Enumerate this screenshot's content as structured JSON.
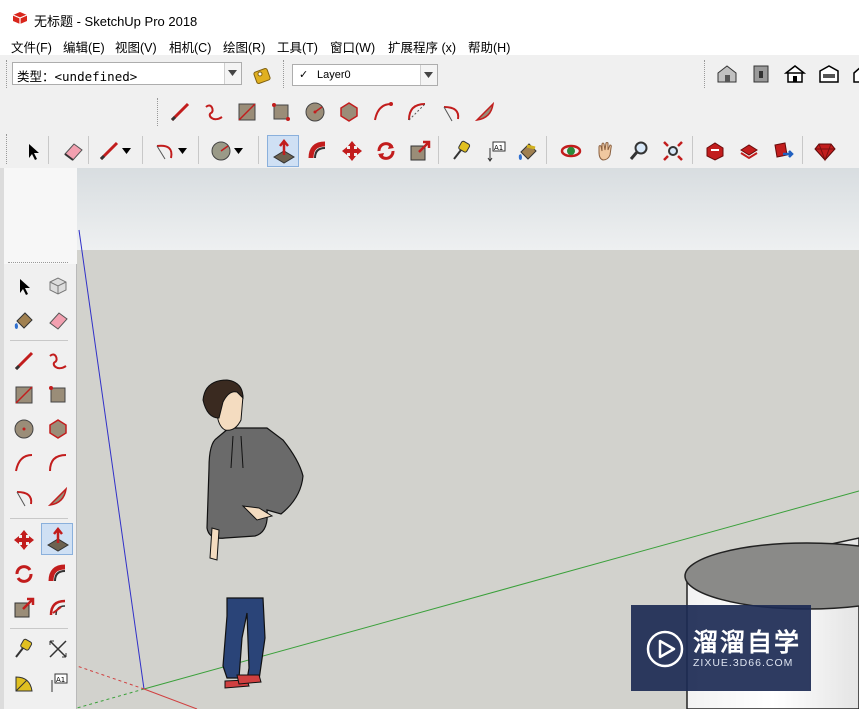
{
  "window": {
    "title": "无标题 - SketchUp Pro 2018"
  },
  "menu": [
    {
      "id": "file",
      "label": "文件(F)"
    },
    {
      "id": "edit",
      "label": "编辑(E)"
    },
    {
      "id": "view",
      "label": "视图(V)"
    },
    {
      "id": "camera",
      "label": "相机(C)"
    },
    {
      "id": "draw",
      "label": "绘图(R)"
    },
    {
      "id": "tools",
      "label": "工具(T)"
    },
    {
      "id": "window",
      "label": "窗口(W)"
    },
    {
      "id": "extensions",
      "label": "扩展程序 (x)"
    },
    {
      "id": "help",
      "label": "帮助(H)"
    }
  ],
  "classifier": {
    "label": "类型：<undefined>"
  },
  "layers": {
    "current": "Layer0",
    "check": "✓"
  },
  "toolbars": {
    "views": [
      "iso-view-icon",
      "top-view-icon",
      "front-view-icon",
      "right-view-icon",
      "back-view-icon"
    ],
    "drawing": [
      "line-icon",
      "freehand-icon",
      "rectangle-icon",
      "rotated-rectangle-icon",
      "circle-icon",
      "polygon-icon",
      "arc-icon",
      "two-point-arc-icon",
      "three-point-arc-icon",
      "pie-icon"
    ],
    "main": [
      "select-icon",
      "eraser-icon",
      "pencil-icon",
      "arc-tool-icon",
      "circle-tool-icon",
      "push-pull-icon",
      "follow-me-icon",
      "move-icon",
      "rotate-icon",
      "scale-icon",
      "tape-measure-icon",
      "text-icon",
      "paint-bucket-icon",
      "orbit-icon",
      "pan-icon",
      "zoom-icon",
      "zoom-extents-icon",
      "warehouse-icon",
      "extension-warehouse-icon",
      "share-model-icon",
      "ruby-console-icon"
    ],
    "active_tool": "push-pull-icon"
  },
  "viewport": {
    "colors": {
      "sky": "#e8ecee",
      "ground": "#d2d2cd",
      "red_axis": "#d04040",
      "green_axis": "#3aa03a",
      "blue_axis": "#3030c8"
    }
  },
  "watermark": {
    "name": "溜溜自学",
    "url": "ZIXUE.3D66.COM"
  }
}
